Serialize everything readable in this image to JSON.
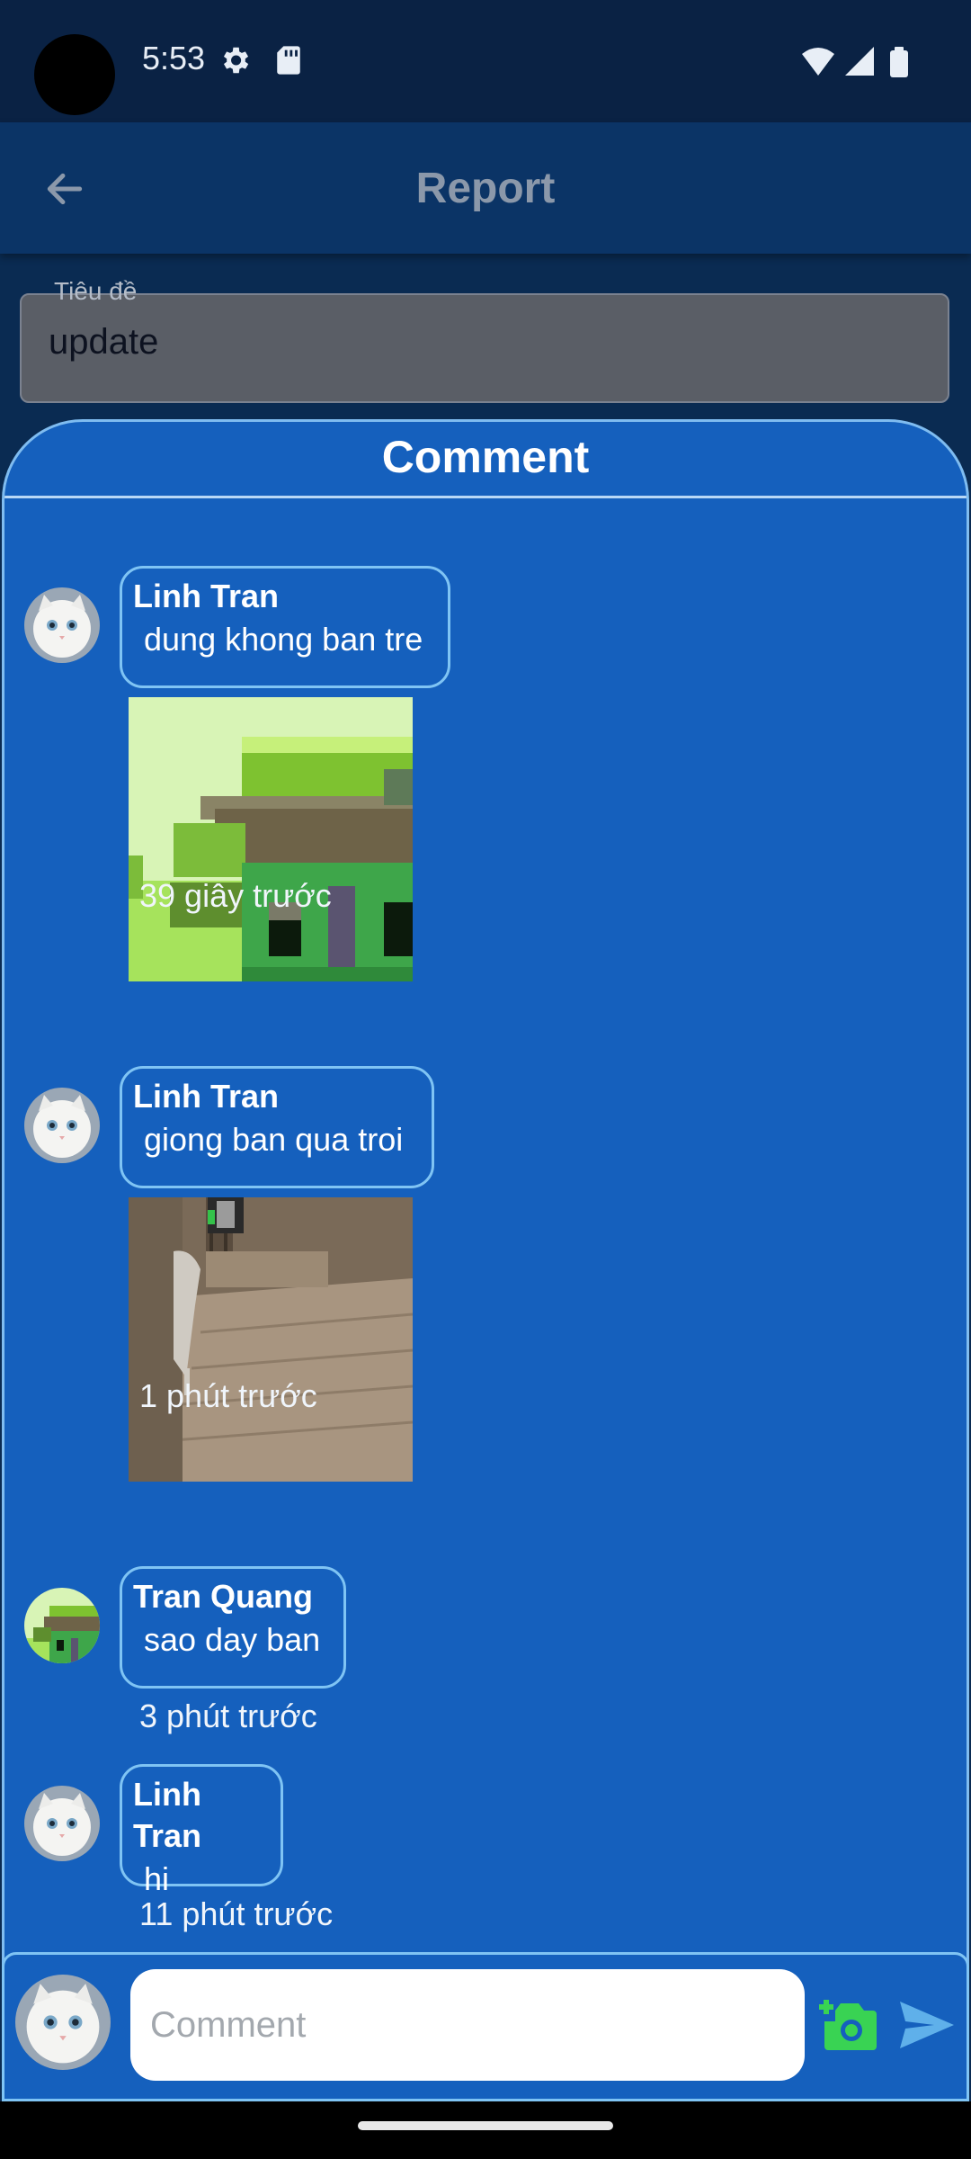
{
  "status_bar": {
    "time": "5:53",
    "icons": [
      "gear-icon",
      "sd-card-icon",
      "wifi-icon",
      "signal-icon",
      "battery-icon"
    ]
  },
  "app_bar": {
    "title": "Report",
    "back_icon": "arrow-left-icon"
  },
  "title_field": {
    "label": "Tiêu đề",
    "value": "update"
  },
  "comments_section": {
    "title": "Comment",
    "comments": [
      {
        "author": "Linh Tran",
        "text": "dung khong ban tre",
        "time": "39 giây trước",
        "avatar": "cat-avatar",
        "attachment": "pixel-house-image"
      },
      {
        "author": "Linh Tran",
        "text": "giong ban qua troi",
        "time": "1 phút trước",
        "avatar": "cat-avatar",
        "attachment": "room-floor-image"
      },
      {
        "author": "Tran Quang",
        "text": "sao day ban",
        "time": "3 phút trước",
        "avatar": "pixel-house-avatar"
      },
      {
        "author": "Linh Tran",
        "text": "hi",
        "time": "11 phút trước",
        "avatar": "cat-avatar"
      }
    ]
  },
  "input_bar": {
    "placeholder": "Comment",
    "camera_icon": "add-photo-icon",
    "send_icon": "send-icon"
  },
  "colors": {
    "background": "#0a2b52",
    "sheet": "#1560bd",
    "border": "#7fc4f4",
    "camera_green": "#39d353",
    "send_blue": "#5fb0ea"
  }
}
